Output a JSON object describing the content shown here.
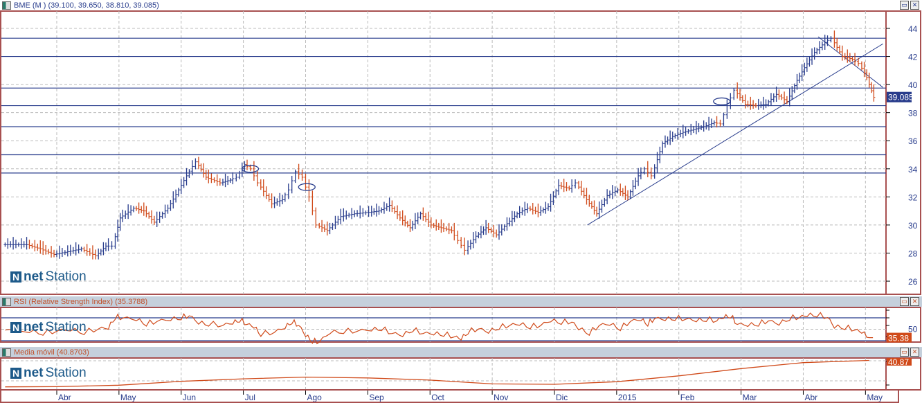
{
  "header": {
    "price_title": "BME (M ) (39.100, 39.650, 38.810, 39.085)",
    "rsi_title": "RSI (Relative Strength Index) (35.3788)",
    "ma_title": "Media móvil (40.8703)",
    "logo_a": "net",
    "logo_b": "Station",
    "maximize": "▭",
    "close": "✕"
  },
  "chart_data": [
    {
      "type": "line",
      "name": "price",
      "subtype": "ohlc",
      "title": "BME (M )",
      "last_label": "39.085",
      "ylim": [
        25,
        45
      ],
      "yticks": [
        26,
        28,
        30,
        32,
        34,
        36,
        38,
        40,
        42,
        44
      ],
      "x_unit": "months since Abr 2014",
      "xlim": [
        -0.89,
        13.33
      ],
      "months": [
        {
          "t": 0,
          "label": "Abr"
        },
        {
          "t": 1,
          "label": "May"
        },
        {
          "t": 2,
          "label": "Jun"
        },
        {
          "t": 3,
          "label": "Jul"
        },
        {
          "t": 4,
          "label": "Ago"
        },
        {
          "t": 5,
          "label": "Sep"
        },
        {
          "t": 6,
          "label": "Oct"
        },
        {
          "t": 7,
          "label": "Nov"
        },
        {
          "t": 8,
          "label": "Dic"
        },
        {
          "t": 9,
          "label": "2015"
        },
        {
          "t": 10,
          "label": "Feb"
        },
        {
          "t": 11,
          "label": "Mar"
        },
        {
          "t": 12,
          "label": "Abr"
        },
        {
          "t": 13,
          "label": "May"
        }
      ],
      "x": [
        -0.83,
        -0.44,
        -0.22,
        0,
        0.22,
        0.44,
        0.67,
        0.83,
        0.94,
        1.06,
        1.28,
        1.44,
        1.61,
        1.83,
        2.0,
        2.13,
        2.28,
        2.44,
        2.67,
        2.83,
        2.94,
        3.06,
        3.17,
        3.28,
        3.5,
        3.67,
        3.78,
        3.89,
        4.0,
        4.11,
        4.22,
        4.39,
        4.61,
        4.83,
        5.06,
        5.22,
        5.39,
        5.56,
        5.72,
        5.89,
        6.06,
        6.22,
        6.39,
        6.5,
        6.61,
        6.78,
        6.94,
        7.11,
        7.28,
        7.44,
        7.61,
        7.78,
        7.94,
        8.11,
        8.28,
        8.39,
        8.56,
        8.72,
        8.89,
        9.06,
        9.22,
        9.39,
        9.5,
        9.61,
        9.78,
        9.94,
        10.11,
        10.28,
        10.44,
        10.61,
        10.72,
        10.83,
        10.94,
        11.11,
        11.28,
        11.44,
        11.61,
        11.78,
        11.94,
        12.06,
        12.22,
        12.39,
        12.5,
        12.67,
        12.83,
        12.94,
        13.06
      ],
      "close": [
        28.6,
        28.3,
        27.9,
        28.1,
        28.3,
        27.8,
        28.5,
        28.5,
        30.5,
        31.2,
        31.0,
        30.2,
        31.2,
        32.5,
        33.5,
        34.5,
        33.4,
        33.0,
        33.2,
        33.4,
        34.3,
        34.0,
        33.0,
        31.5,
        31.8,
        32.5,
        33.8,
        33.4,
        32.0,
        30.0,
        29.6,
        30.6,
        30.8,
        30.9,
        31.0,
        31.4,
        30.5,
        29.8,
        30.8,
        30.0,
        29.8,
        29.6,
        28.9,
        28.2,
        29.2,
        29.8,
        29.3,
        30.1,
        30.8,
        31.2,
        30.9,
        31.3,
        32.8,
        32.6,
        33.0,
        31.8,
        30.8,
        32.1,
        32.5,
        32.0,
        33.5,
        34.0,
        33.5,
        35.8,
        36.3,
        36.6,
        36.8,
        37.0,
        37.3,
        37.2,
        38.5,
        39.6,
        38.6,
        38.5,
        38.6,
        39.3,
        38.8,
        40.3,
        41.2,
        42.3,
        43.0,
        43.3,
        42.0,
        41.8,
        41.5,
        40.5,
        39.085
      ],
      "levels": [
        43.3,
        42.0,
        39.75,
        38.5,
        37.0,
        35.0,
        33.7
      ],
      "trendlines": [
        {
          "from": [
            8.53,
            30.0
          ],
          "to": [
            13.28,
            42.9
          ]
        },
        {
          "from": [
            12.24,
            43.4
          ],
          "to": [
            13.28,
            39.8
          ]
        }
      ],
      "markers": [
        {
          "t": 3.11,
          "v": 34.0
        },
        {
          "t": 4.02,
          "v": 32.7
        },
        {
          "t": 10.69,
          "v": 38.8
        }
      ],
      "colors": {
        "up": "#283c8c",
        "down": "#d04a1a",
        "level": "#283c8c"
      }
    },
    {
      "type": "line",
      "name": "rsi",
      "title": "RSI (Relative Strength Index)",
      "last_label": "35.38",
      "ylim": [
        25,
        80
      ],
      "levels": [
        70,
        30
      ],
      "yticks": [
        50
      ],
      "values": [
        50,
        47,
        44,
        48,
        50,
        45,
        52,
        53,
        72,
        71,
        68,
        60,
        65,
        68,
        71,
        75,
        62,
        60,
        58,
        62,
        67,
        60,
        55,
        42,
        46,
        54,
        64,
        58,
        40,
        30,
        29,
        45,
        47,
        48,
        50,
        52,
        44,
        40,
        50,
        44,
        43,
        42,
        38,
        34,
        46,
        52,
        46,
        54,
        58,
        60,
        55,
        58,
        66,
        63,
        64,
        52,
        44,
        58,
        60,
        52,
        65,
        68,
        60,
        70,
        68,
        70,
        69,
        66,
        68,
        66,
        72,
        74,
        60,
        58,
        60,
        66,
        60,
        70,
        72,
        75,
        76,
        72,
        55,
        54,
        50,
        46,
        35.38
      ]
    },
    {
      "type": "line",
      "name": "moving-average",
      "title": "Media móvil",
      "last_label": "40.87",
      "ylim": [
        27,
        42
      ],
      "t": [
        -0.83,
        0,
        1,
        2,
        3,
        4,
        5,
        6,
        7,
        8,
        9,
        10,
        11,
        12,
        13.06
      ],
      "values": [
        28.4,
        28.5,
        29.2,
        31.0,
        32.2,
        33.0,
        32.6,
        31.6,
        29.8,
        29.6,
        30.8,
        33.6,
        37.0,
        39.8,
        40.87
      ]
    }
  ]
}
